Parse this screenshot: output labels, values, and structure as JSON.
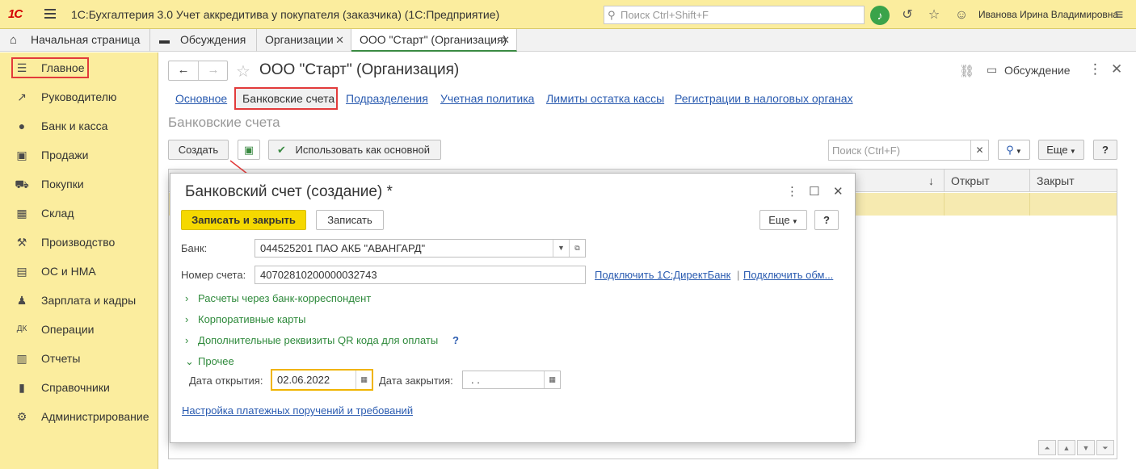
{
  "app": {
    "logo": "1С",
    "title": "1С:Бухгалтерия 3.0 Учет аккредитива у покупателя (заказчика)  (1С:Предприятие)",
    "search_placeholder": "Поиск Ctrl+Shift+F",
    "user": "Иванова Ирина Владимировна"
  },
  "tabs": [
    {
      "label": "Начальная страница"
    },
    {
      "label": "Обсуждения"
    },
    {
      "label": "Организации"
    },
    {
      "label": "ООО \"Старт\" (Организация)"
    }
  ],
  "sidebar": {
    "items": [
      {
        "label": "Главное",
        "icon": "menu-lines-icon"
      },
      {
        "label": "Руководителю",
        "icon": "trend-icon"
      },
      {
        "label": "Банк и касса",
        "icon": "coin-icon"
      },
      {
        "label": "Продажи",
        "icon": "shopping-bag-icon"
      },
      {
        "label": "Покупки",
        "icon": "cart-icon"
      },
      {
        "label": "Склад",
        "icon": "warehouse-icon"
      },
      {
        "label": "Производство",
        "icon": "factory-icon"
      },
      {
        "label": "ОС и НМА",
        "icon": "assets-icon"
      },
      {
        "label": "Зарплата и кадры",
        "icon": "person-icon"
      },
      {
        "label": "Операции",
        "icon": "operations-icon"
      },
      {
        "label": "Отчеты",
        "icon": "bar-chart-icon"
      },
      {
        "label": "Справочники",
        "icon": "book-icon"
      },
      {
        "label": "Администрирование",
        "icon": "gear-icon"
      }
    ]
  },
  "page": {
    "title": "ООО \"Старт\" (Организация)",
    "discussion_label": "Обсуждение",
    "sublinks": [
      {
        "label": "Основное"
      },
      {
        "label": "Банковские счета"
      },
      {
        "label": "Подразделения"
      },
      {
        "label": "Учетная политика"
      },
      {
        "label": "Лимиты остатка кассы"
      },
      {
        "label": "Регистрации в налоговых органах"
      }
    ],
    "section_title": "Банковские счета",
    "toolbar": {
      "create_label": "Создать",
      "use_as_main_label": "Использовать как основной",
      "search_placeholder": "Поиск (Ctrl+F)",
      "more_label": "Еще",
      "help_label": "?"
    },
    "table": {
      "columns": [
        "↓",
        "Открыт",
        "Закрыт"
      ]
    }
  },
  "dialog": {
    "title": "Банковский счет (создание) *",
    "save_close_label": "Записать и закрыть",
    "save_label": "Записать",
    "more_label": "Еще",
    "help_label": "?",
    "bank_label": "Банк:",
    "bank_value": "044525201 ПАО АКБ \"АВАНГАРД\"",
    "account_label": "Номер счета:",
    "account_value": "40702810200000032743",
    "link_directbank": "Подключить 1С:ДиректБанк",
    "link_separator": "|",
    "link_exchange": "Подключить обм...",
    "groups": [
      {
        "label": "Расчеты через банк-корреспондент"
      },
      {
        "label": "Корпоративные карты"
      },
      {
        "label": "Дополнительные реквизиты QR кода для оплаты"
      },
      {
        "label": "Прочее"
      }
    ],
    "qr_help": "?",
    "open_date_label": "Дата открытия:",
    "open_date_value": "02.06.2022",
    "close_date_label": "Дата закрытия:",
    "close_date_value": " .  .",
    "payment_settings_link": "Настройка платежных поручений и требований"
  },
  "colors": {
    "brand_yellow": "#fbed9e",
    "accent_green": "#3aa34a",
    "link_blue": "#2a5bb0",
    "highlight_red": "#e23b3b",
    "primary_button": "#f5d800"
  }
}
